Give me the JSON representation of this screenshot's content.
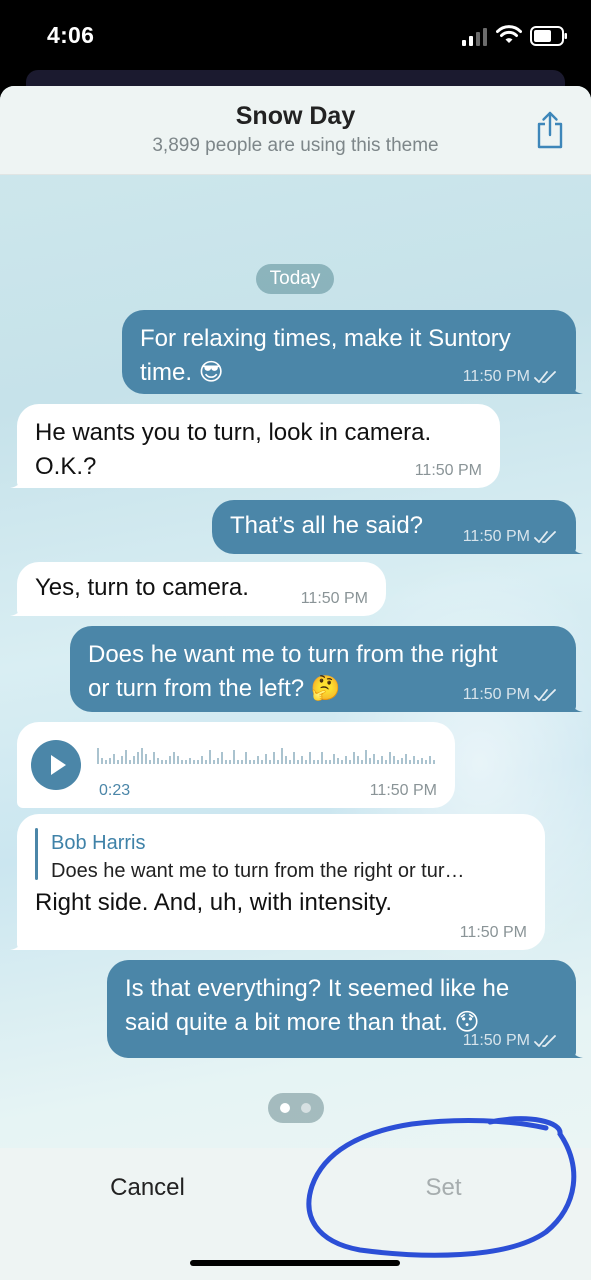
{
  "status_bar": {
    "time": "4:06"
  },
  "theme": {
    "title": "Snow Day",
    "subtitle": "3,899 people are using this theme"
  },
  "chat": {
    "date_label": "Today",
    "messages": [
      {
        "direction": "out",
        "text": "For relaxing times, make it Suntory\ntime. 😎",
        "time": "11:50 PM",
        "read": true
      },
      {
        "direction": "in",
        "text": "He wants you to turn, look in camera.\nO.K.?",
        "time": "11:50 PM"
      },
      {
        "direction": "out",
        "text": "That’s all he said?",
        "time": "11:50 PM",
        "read": true
      },
      {
        "direction": "in",
        "text": "Yes, turn to camera.",
        "time": "11:50 PM"
      },
      {
        "direction": "out",
        "text": "Does he want me to turn from the right\nor turn from the left? 🤔",
        "time": "11:50 PM",
        "read": true
      },
      {
        "direction": "in",
        "type": "voice",
        "duration": "0:23",
        "time": "11:50 PM"
      },
      {
        "direction": "in",
        "type": "reply",
        "reply_to_name": "Bob Harris",
        "reply_to_text": "Does he want me to turn from the right or tur…",
        "text": "Right side. And, uh, with intensity.",
        "time": "11:50 PM"
      },
      {
        "direction": "out",
        "text": "Is that everything? It seemed like he\nsaid quite a bit more than that. 😯",
        "time": "11:50 PM",
        "read": true
      }
    ]
  },
  "footer": {
    "cancel_label": "Cancel",
    "set_label": "Set"
  },
  "colors": {
    "outgoing_bubble": "#4b86a8",
    "incoming_bubble": "#ffffff",
    "annotation_stroke": "#2c4fd6"
  },
  "icons": {
    "share": "share-icon",
    "play": "play-icon",
    "read_checks": "double-check-icon",
    "signal": "cellular-signal-icon",
    "wifi": "wifi-icon",
    "battery": "battery-icon"
  }
}
